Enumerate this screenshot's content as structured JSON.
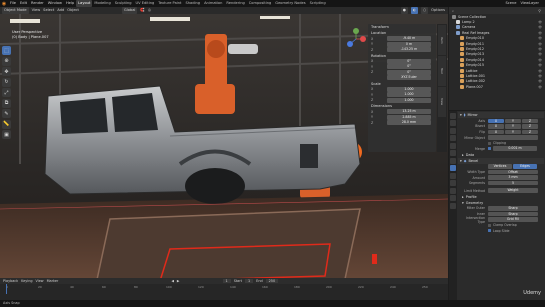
{
  "topbar": {
    "menus": [
      "File",
      "Edit",
      "Render",
      "Window",
      "Help"
    ],
    "workspaces": [
      "Layout",
      "Modeling",
      "Sculpting",
      "UV Editing",
      "Texture Paint",
      "Shading",
      "Animation",
      "Rendering",
      "Compositing",
      "Geometry Nodes",
      "Scripting"
    ],
    "active_workspace": "Layout",
    "scene_label": "Scene",
    "view_layer_label": "ViewLayer"
  },
  "viewport_header": {
    "mode": "Object Mode",
    "menus": [
      "View",
      "Select",
      "Add",
      "Object"
    ],
    "transform": "Global",
    "options_label": "Options"
  },
  "viewport": {
    "view_name": "User Perspective",
    "object_info": "(0) Body | Plane.007"
  },
  "tools": [
    "select-icon",
    "cursor-icon",
    "move-icon",
    "rotate-icon",
    "scale-icon",
    "transform-icon",
    "annotate-icon",
    "measure-icon",
    "add-cube-icon"
  ],
  "npanel": {
    "transform_title": "Transform",
    "location_title": "Location",
    "location": [
      "-9.40 m",
      "0 m",
      "-143.25 m"
    ],
    "rotation_title": "Rotation",
    "rotation": [
      "0°",
      "0°",
      "0°"
    ],
    "mode_label": "XYZ Euler",
    "scale_title": "Scale",
    "scale": [
      "1.000",
      "1.000",
      "1.000"
    ],
    "dimensions_title": "Dimensions",
    "dimensions": [
      "13.25 m",
      "2.885 m",
      "28.0 mm"
    ],
    "axis_labels": [
      "X",
      "Y",
      "Z"
    ],
    "tabs": [
      "Item",
      "Tool",
      "View"
    ]
  },
  "outliner": {
    "title": "Scene Collection",
    "items": [
      {
        "label": "Lamp 2",
        "color": "#d9d9d9"
      },
      {
        "label": "Camera",
        "color": "#7f9ecc"
      },
      {
        "label": "Real Ref Images",
        "color": "#7f9ecc"
      },
      {
        "label": "Empty.010",
        "color": "#d9a05a"
      },
      {
        "label": "Empty.011",
        "color": "#d9a05a"
      },
      {
        "label": "Empty.012",
        "color": "#d9a05a"
      },
      {
        "label": "Empty.013",
        "color": "#d9a05a"
      },
      {
        "label": "Empty.014",
        "color": "#d9a05a"
      },
      {
        "label": "Empty.015",
        "color": "#d9a05a"
      },
      {
        "label": "Lattice",
        "color": "#d9a05a"
      },
      {
        "label": "Lattice.001",
        "color": "#d9a05a"
      },
      {
        "label": "Lattice.002",
        "color": "#d9a05a"
      },
      {
        "label": "Plane.007",
        "color": "#d9a05a"
      }
    ]
  },
  "properties": {
    "mirror_title": "Mirror",
    "axis_label": "Axis",
    "bisect_label": "Bisect",
    "flip_label": "Flip",
    "axis_values": [
      "X",
      "Y",
      "Z"
    ],
    "mirror_object_label": "Mirror Object",
    "clipping_label": "Clipping",
    "merge_label": "Merge",
    "merge_value": "0.001 m",
    "data_label": "Data",
    "bevel_title": "Bevel",
    "vertices_label": "Vertices",
    "edges_label": "Edges",
    "width_type_label": "Width Type",
    "width_type_value": "Offset",
    "amount_label": "Amount",
    "amount_value": "3 mm",
    "segments_label": "Segments",
    "segments_value": "5",
    "limit_method_label": "Limit Method",
    "limit_method_value": "Weight",
    "profile_label": "Profile",
    "geometry_label": "Geometry",
    "miter_outer_label": "Miter Outer",
    "miter_outer_value": "Sharp",
    "inner_label": "Inner",
    "inner_value": "Sharp",
    "intersection_label": "Intersection Type",
    "intersection_value": "Grid Fill",
    "clamp_overlap_label": "Clamp Overlap",
    "loop_slide_label": "Loop Slide"
  },
  "timeline": {
    "menus": [
      "Playback",
      "Keying",
      "View",
      "Marker"
    ],
    "ticks": [
      "0",
      "20",
      "40",
      "60",
      "80",
      "100",
      "120",
      "140",
      "160",
      "180",
      "200",
      "220",
      "240",
      "250"
    ],
    "current_frame": "1",
    "start_label": "Start",
    "start_value": "1",
    "end_label": "End",
    "end_value": "250"
  },
  "status": {
    "text": "Axis Snap"
  },
  "watermark": "Udemy",
  "colors": {
    "accent": "#4772b3",
    "robot_orange": "#d9602a",
    "highlight_red": "#e02a1a"
  }
}
